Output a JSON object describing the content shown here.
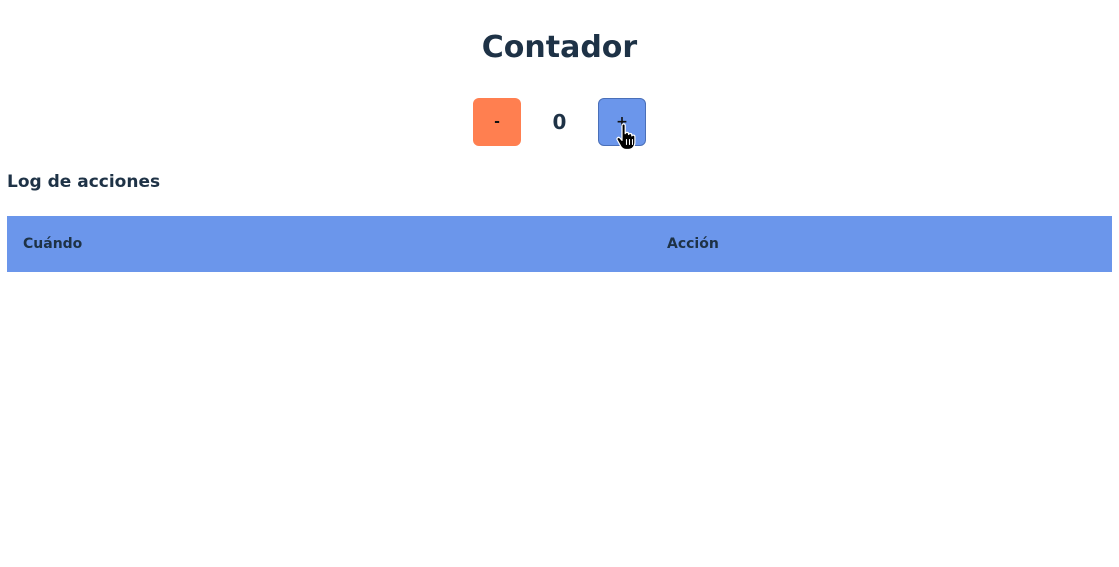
{
  "title": "Contador",
  "counter": {
    "decrement_label": "-",
    "value": "0",
    "increment_label": "+"
  },
  "log": {
    "title": "Log de acciones",
    "columns": [
      "Cuándo",
      "Acción"
    ],
    "rows": []
  },
  "colors": {
    "decrement_button": "#ff7f50",
    "increment_button": "#6b96eb",
    "table_header": "#6b96eb",
    "text": "#1e3246"
  }
}
